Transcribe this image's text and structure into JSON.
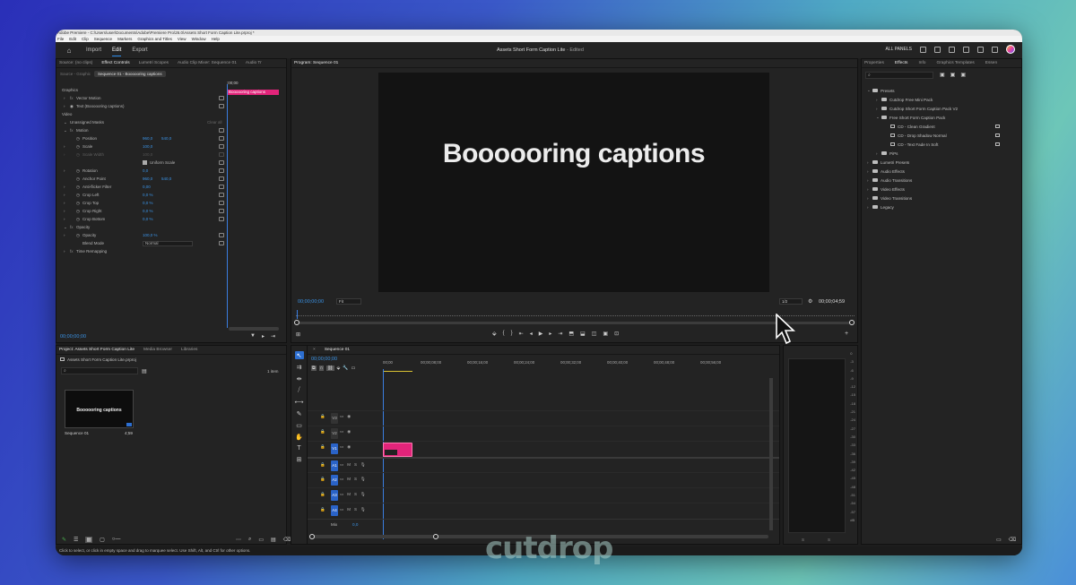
{
  "titlebar": {
    "title": "Adobe Premiere - C:\\Users\\user\\Documents\\Adobe\\Premiere Pro\\26.0\\Assets Short Form Caption Lite.prproj *"
  },
  "menu": [
    "File",
    "Edit",
    "Clip",
    "Sequence",
    "Markers",
    "Graphics and Titles",
    "View",
    "Window",
    "Help"
  ],
  "workspace": {
    "tabs": [
      "Import",
      "Edit",
      "Export"
    ],
    "active": "Edit",
    "project_title": "Assets Short Form Caption Lite",
    "edited": "- Edited",
    "all_panels": "ALL PANELS"
  },
  "effect_controls": {
    "tabs": [
      "Source: (no clips)",
      "Effect Controls",
      "Lumetri Scopes",
      "Audio Clip Mixer: Sequence 01",
      "Audio Tr"
    ],
    "source_label": "Source - Graphic",
    "sequence_button": "Sequence 01 - Boooooring captions",
    "mini_clip": "Boooooring captions",
    "mini_time": ":00;00",
    "sections": {
      "graphics": "Graphics",
      "vector_motion": "Vector Motion",
      "text": "Text (Boooooring captions)",
      "video": "Video",
      "unassigned": "Unassigned Masks",
      "clear_all": "Clear all",
      "motion": "Motion",
      "opacity_group": "Opacity",
      "time_remap": "Time Remapping"
    },
    "props": [
      {
        "name": "Position",
        "v1": "960,0",
        "v2": "540,0"
      },
      {
        "name": "Scale",
        "v1": "100,0",
        "v2": ""
      },
      {
        "name": "Scale Width",
        "v1": "100,0",
        "v2": ""
      },
      {
        "name": "Uniform Scale",
        "v1": "",
        "v2": ""
      },
      {
        "name": "Rotation",
        "v1": "0,0",
        "v2": ""
      },
      {
        "name": "Anchor Point",
        "v1": "960,0",
        "v2": "540,0"
      },
      {
        "name": "Anti-flicker Filter",
        "v1": "0,00",
        "v2": ""
      },
      {
        "name": "Crop Left",
        "v1": "0,0 %",
        "v2": ""
      },
      {
        "name": "Crop Top",
        "v1": "0,0 %",
        "v2": ""
      },
      {
        "name": "Crop Right",
        "v1": "0,0 %",
        "v2": ""
      },
      {
        "name": "Crop Bottom",
        "v1": "0,0 %",
        "v2": ""
      }
    ],
    "opacity": {
      "name": "Opacity",
      "value": "100,0 %"
    },
    "blend": {
      "name": "Blend Mode",
      "value": "Normal"
    },
    "timecode": "00;00;00;00"
  },
  "program": {
    "tab": "Program: Sequence 01",
    "caption": "Boooooring captions",
    "timecode_in": "00;00;00;00",
    "fit": "Fit",
    "resolution": "1/2",
    "timecode_out": "00;00;04;59"
  },
  "project": {
    "tabs": [
      "Project: Assets Short Form Caption Lite",
      "Media Browser",
      "Libraries"
    ],
    "file": "Assets Short Form Caption Lite.prproj",
    "count": "1 item",
    "thumb_text": "Boooooring captions",
    "item_name": "Sequence 01",
    "item_duration": "4;59"
  },
  "timeline": {
    "tab": "Sequence 01",
    "timecode": "00;00;00;00",
    "ruler": [
      "00;00",
      "00;00;08;00",
      "00;00;16;00",
      "00;00;24;00",
      "00;00;32;00",
      "00;00;40;00",
      "00;00;48;00",
      "00;00;56;00"
    ],
    "tracks": [
      "V3",
      "V2",
      "V1",
      "A1",
      "A2",
      "A3",
      "A4"
    ],
    "mix_label": "Mix",
    "mix_value": "0,0"
  },
  "effects_panel": {
    "tabs": [
      "Properties",
      "Effects",
      "Info",
      "Graphics Templates",
      "Essen"
    ],
    "tree": [
      {
        "label": "Presets",
        "level": 0,
        "open": true
      },
      {
        "label": "Cutdrop Free Mini Pack",
        "level": 1
      },
      {
        "label": "Cutdrop Short Form Caption Pack V2",
        "level": 1
      },
      {
        "label": "Free Short Form Caption Pack",
        "level": 1,
        "open": true
      },
      {
        "label": "CD - Clean Gradient",
        "level": 2,
        "preset": true
      },
      {
        "label": "CD - Drop Shadow Normal",
        "level": 2,
        "preset": true
      },
      {
        "label": "CD - Text Fade In Soft",
        "level": 2,
        "preset": true
      },
      {
        "label": "PiPs",
        "level": 1
      },
      {
        "label": "Lumetri Presets",
        "level": 0
      },
      {
        "label": "Audio Effects",
        "level": 0
      },
      {
        "label": "Audio Transitions",
        "level": 0
      },
      {
        "label": "Video Effects",
        "level": 0
      },
      {
        "label": "Video Transitions",
        "level": 0
      },
      {
        "label": "Legacy",
        "level": 0
      }
    ]
  },
  "meter": {
    "scale": [
      "0",
      "-3",
      "-6",
      "-9",
      "-12",
      "-15",
      "-18",
      "-21",
      "-24",
      "-27",
      "-30",
      "-33",
      "-36",
      "-39",
      "-42",
      "-45",
      "-48",
      "-51",
      "-54",
      "-57",
      "dB"
    ],
    "bottom": [
      "S",
      "S"
    ]
  },
  "status": "Click to select, or click in empty space and drag to marquee select. Use Shift, Alt, and Ctrl for other options.",
  "watermark": "cutdrop"
}
